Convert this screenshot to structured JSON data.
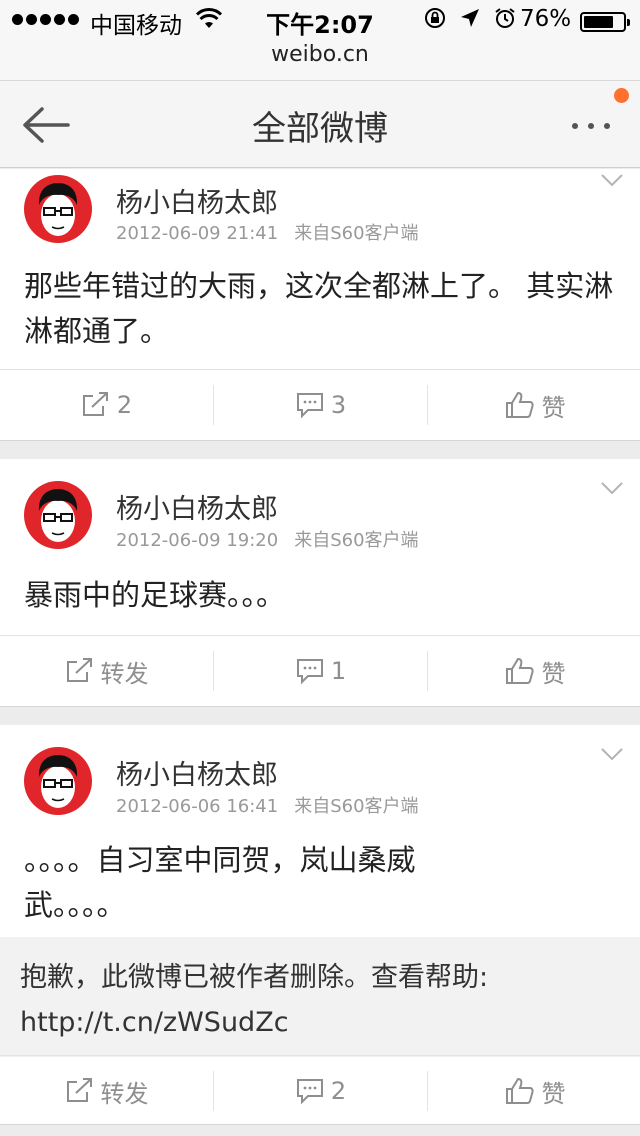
{
  "status_bar": {
    "carrier": "中国移动",
    "time": "下午2:07",
    "battery": "76%",
    "battery_level": 0.76,
    "url": "weibo.cn",
    "icons": [
      "signal-icon",
      "wifi-icon",
      "orientation-lock-icon",
      "location-icon",
      "alarm-icon",
      "battery-icon"
    ]
  },
  "nav": {
    "title": "全部微博",
    "back_icon": "arrow-left-icon",
    "more_icon": "ellipsis-icon",
    "badge_color": "#ff7031"
  },
  "posts": [
    {
      "author": "杨小白杨太郎",
      "date": "2012-06-09 21:41",
      "source": "来自S60客户端",
      "text": "那些年错过的大雨，这次全都淋上了。 其实淋淋都通了。",
      "repost": "2",
      "comment": "3",
      "like": "赞"
    },
    {
      "author": "杨小白杨太郎",
      "date": "2012-06-09 19:20",
      "source": "来自S60客户端",
      "text": "暴雨中的足球赛。。。",
      "repost": "转发",
      "comment": "1",
      "like": "赞"
    },
    {
      "author": "杨小白杨太郎",
      "date": "2012-06-06 16:41",
      "source": "来自S60客户端",
      "text_line1": "。。。。自习室中同贺，岚山桑威",
      "text_line2": "武。。。。",
      "deleted_line1": "抱歉，此微博已被作者删除。查看帮助:",
      "deleted_line2": "http://t.cn/zWSudZc",
      "repost": "转发",
      "comment": "2",
      "like": "赞"
    }
  ],
  "colors": {
    "avatar_bg": "#e0262b",
    "action_text": "#8e8e8e"
  }
}
